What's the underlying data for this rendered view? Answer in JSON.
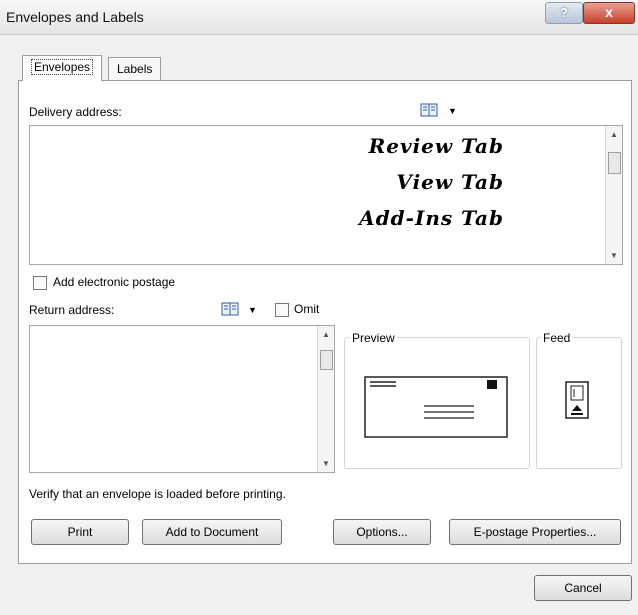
{
  "window": {
    "title": "Envelopes and Labels",
    "help_glyph": "?",
    "close_glyph": "x"
  },
  "tabs": [
    {
      "label": "Envelopes",
      "active": true
    },
    {
      "label": "Labels",
      "active": false
    }
  ],
  "delivery": {
    "label": "Delivery address:",
    "lines": [
      "Review Tab",
      "View Tab",
      "Add-Ins Tab"
    ],
    "book_icon": "address-book-icon"
  },
  "postage": {
    "label": "Add electronic postage",
    "checked": false
  },
  "return": {
    "label": "Return address:",
    "omit_label": "Omit",
    "omit_checked": false,
    "value": ""
  },
  "preview": {
    "label": "Preview"
  },
  "feed": {
    "label": "Feed"
  },
  "note": "Verify that an envelope is loaded before printing.",
  "buttons": {
    "print": "Print",
    "add_to_document": "Add to Document",
    "options": "Options...",
    "epostage": "E-postage Properties...",
    "cancel": "Cancel"
  }
}
